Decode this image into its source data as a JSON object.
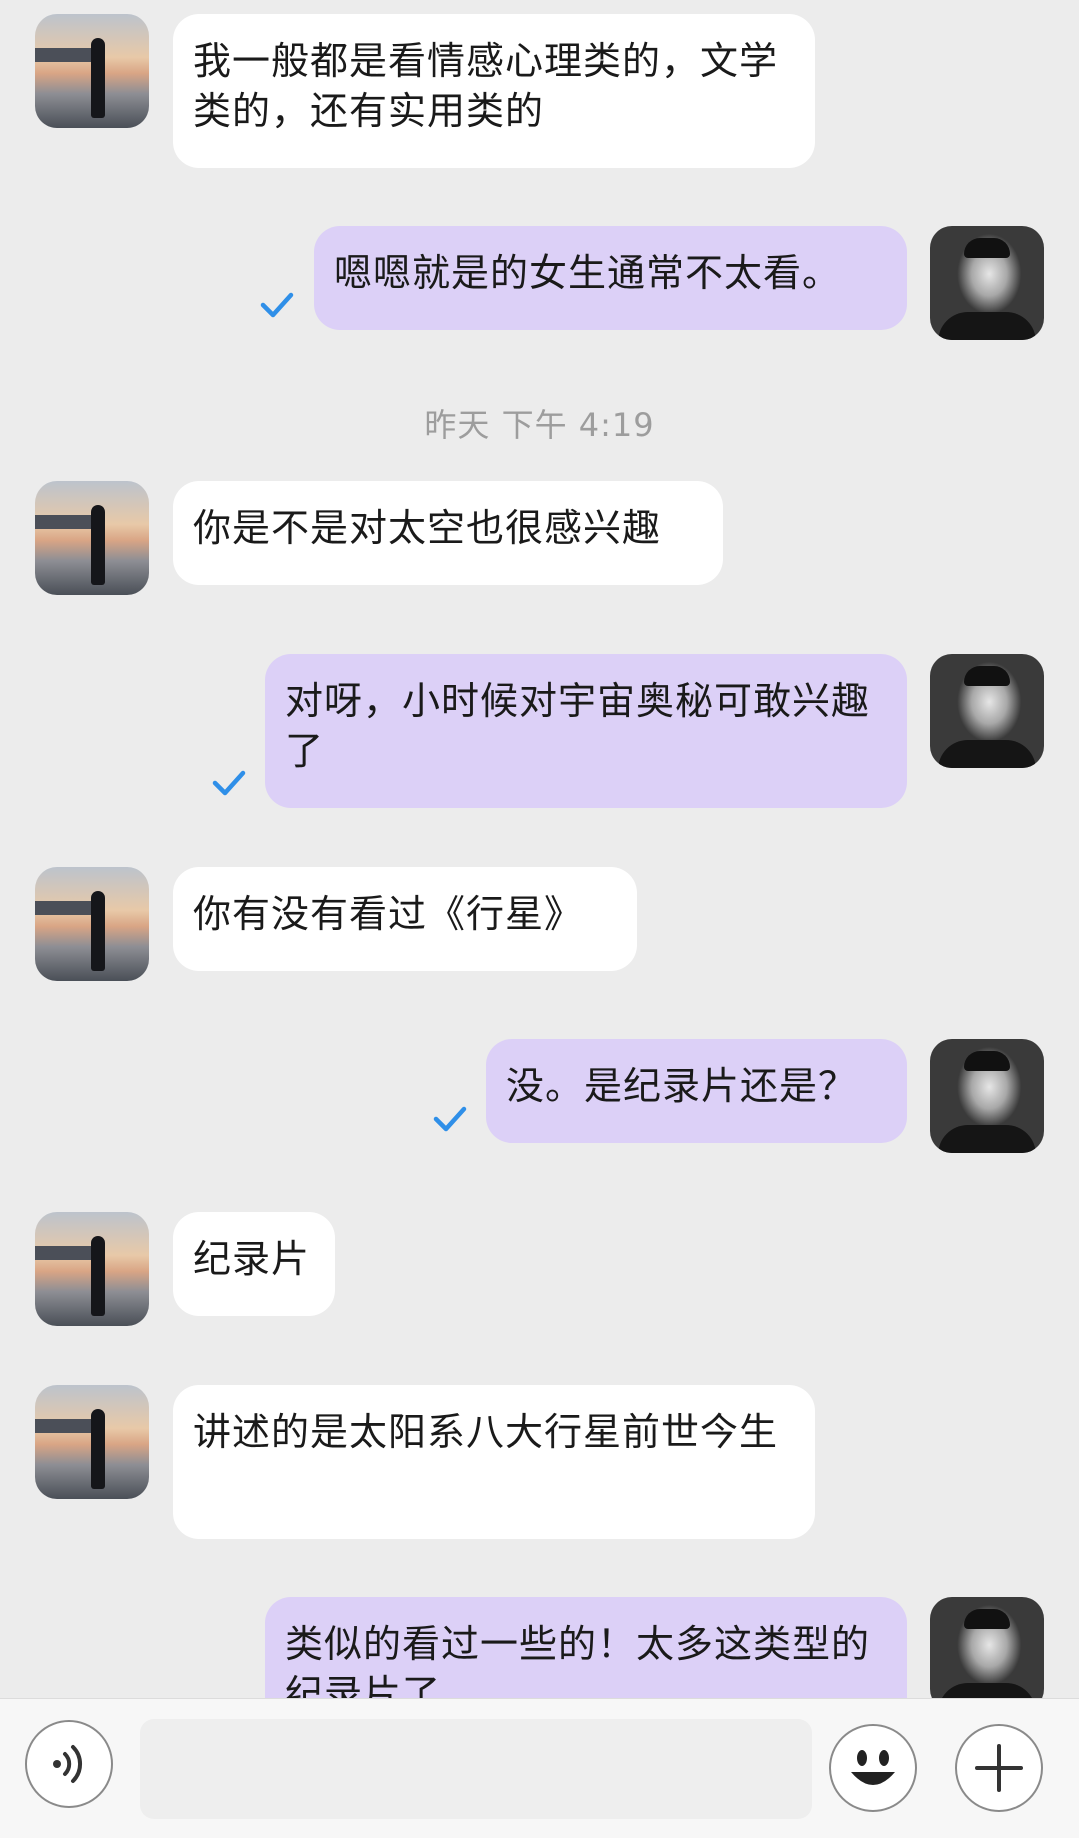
{
  "messages": [
    {
      "side": "left",
      "text": "我一般都是看情感心理类的，文学类的，还有实用类的"
    },
    {
      "side": "right",
      "text": "嗯嗯就是的女生通常不太看。",
      "status": "read-check"
    },
    {
      "timestamp": "昨天 下午 4:19"
    },
    {
      "side": "left",
      "text": "你是不是对太空也很感兴趣"
    },
    {
      "side": "right",
      "text": "对呀，小时候对宇宙奥秘可敢兴趣了",
      "status": "read-check"
    },
    {
      "side": "left",
      "text": "你有没有看过《行星》"
    },
    {
      "side": "right",
      "text": "没。是纪录片还是？",
      "status": "read-check"
    },
    {
      "side": "left",
      "text": "纪录片"
    },
    {
      "side": "left",
      "text": "讲述的是太阳系八大行星前世今生"
    },
    {
      "side": "right",
      "text": "类似的看过一些的！太多这类型的纪录片了"
    }
  ],
  "input": {
    "value": "",
    "voice_icon": "voice-icon",
    "emoji_icon": "emoji-icon",
    "plus_icon": "plus-icon"
  },
  "colors": {
    "background": "#ececec",
    "bubble_left": "#ffffff",
    "bubble_right": "#dcd0f7",
    "check": "#2f8fe8"
  }
}
